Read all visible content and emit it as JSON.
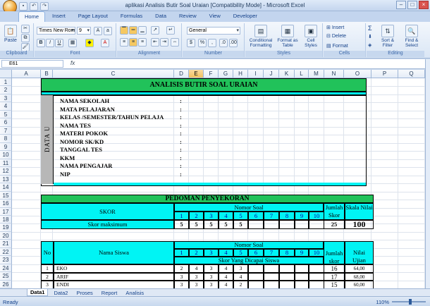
{
  "window": {
    "title": "aplikasi Analisis Butir Soal Uraian  [Compatibility Mode] - Microsoft Excel"
  },
  "tabs": [
    "Home",
    "Insert",
    "Page Layout",
    "Formulas",
    "Data",
    "Review",
    "View",
    "Developer"
  ],
  "ribbon": {
    "clipboard": {
      "label": "Clipboard",
      "paste": "Paste"
    },
    "font": {
      "label": "Font",
      "name": "Times New Rom",
      "size": "9"
    },
    "alignment": {
      "label": "Alignment"
    },
    "number": {
      "label": "Number",
      "format": "General"
    },
    "styles": {
      "label": "Styles",
      "conditional": "Conditional Formatting",
      "format_table": "Format as Table",
      "cell_styles": "Cell Styles"
    },
    "cells": {
      "label": "Cells",
      "insert": "Insert",
      "delete": "Delete",
      "format": "Format"
    },
    "editing": {
      "label": "Editing",
      "sort": "Sort & Filter",
      "find": "Find & Select"
    }
  },
  "formula_bar": {
    "name_box": "E61",
    "fx": "fx"
  },
  "columns": [
    "A",
    "B",
    "C",
    "D",
    "E",
    "F",
    "G",
    "H",
    "I",
    "J",
    "K",
    "L",
    "M",
    "N",
    "O",
    "P",
    "Q"
  ],
  "selected_column": "E",
  "rows": [
    "1",
    "2",
    "3",
    "4",
    "5",
    "6",
    "7",
    "8",
    "9",
    "10",
    "11",
    "12",
    "13",
    "14",
    "15",
    "16",
    "17",
    "18",
    "19",
    "20",
    "21",
    "22",
    "23",
    "24",
    "25",
    "26"
  ],
  "sheet": {
    "title": "ANALISIS BUTIR SOAL URAIAN",
    "side_label": "DATA UMUM",
    "fields": [
      "NAMA SEKOLAH",
      "MATA PELAJARAN",
      "KELAS /SEMESTER/TAHUN PELAJA",
      "NAMA TES",
      "MATERI POKOK",
      "NOMOR SK/KD",
      "TANGGAL TES",
      "KKM",
      "NAMA PENGAJAR",
      "NIP"
    ],
    "colon": ":",
    "pedoman": "PEDOMAN PENYEKORAN",
    "skor": "SKOR",
    "nomor_soal": "Nomor Soal",
    "soal_numbers": [
      "1",
      "2",
      "3",
      "4",
      "5",
      "6",
      "7",
      "8",
      "9",
      "10"
    ],
    "jumlah_skor": "Jumlah Skor",
    "skala_nilai": "Skala Nilai",
    "skor_maksimum": "Skor maksimum",
    "max_scores": [
      "5",
      "5",
      "5",
      "5",
      "5"
    ],
    "jumlah_max": "25",
    "skala_max": "100",
    "no": "No",
    "nama_siswa": "Nama Siswa",
    "skor_dicapai": "Skor Yang Dicapai Siswa",
    "jumlah": "Jumlah",
    "skor_lbl": "skor",
    "nilai": "Nilai",
    "ujian": "Ujian",
    "students": [
      {
        "no": "1",
        "name": "EKO",
        "scores": [
          "2",
          "4",
          "3",
          "4",
          "3"
        ],
        "total": "16",
        "nilai": "64,00"
      },
      {
        "no": "2",
        "name": "ARIF",
        "scores": [
          "3",
          "3",
          "3",
          "4",
          "4"
        ],
        "total": "17",
        "nilai": "68,00"
      },
      {
        "no": "3",
        "name": "ENDI",
        "scores": [
          "3",
          "3",
          "3",
          "4",
          "2"
        ],
        "total": "15",
        "nilai": "60,00"
      }
    ]
  },
  "sheet_tabs": [
    "Data1",
    "Data2",
    "Proses",
    "Report",
    "Analisis"
  ],
  "status": {
    "ready": "Ready",
    "zoom": "110%"
  }
}
